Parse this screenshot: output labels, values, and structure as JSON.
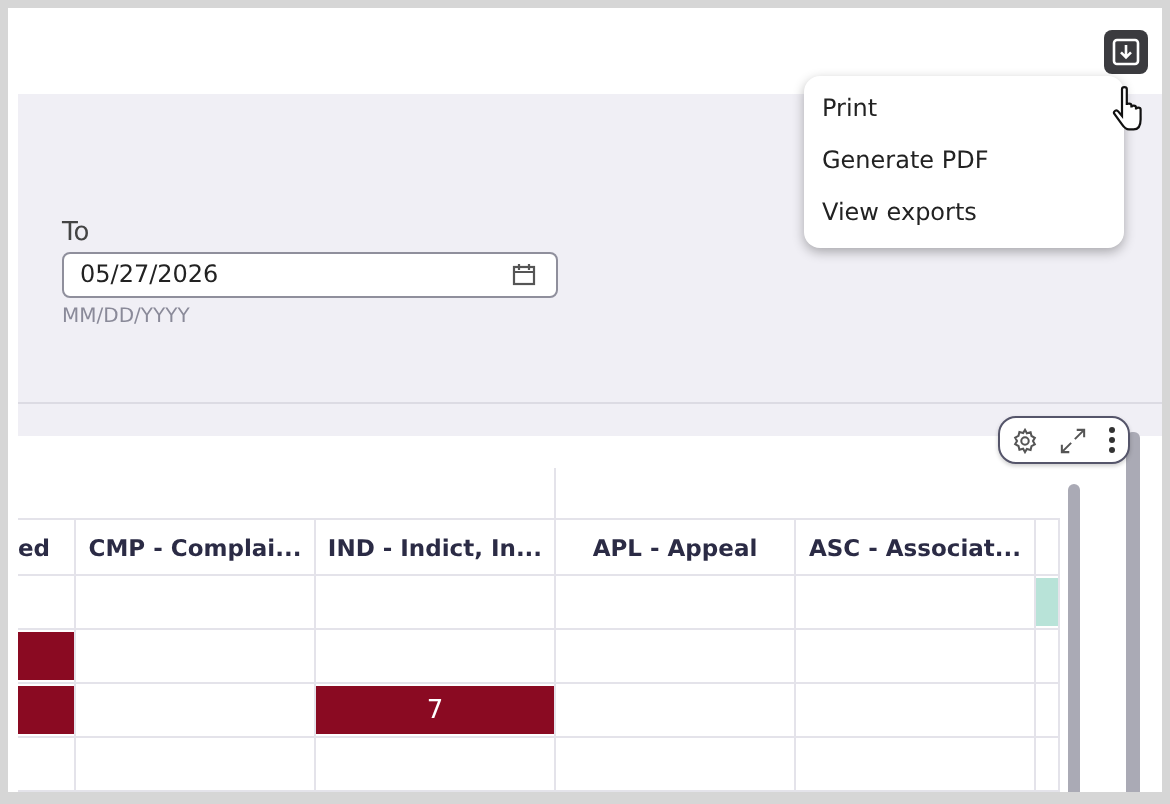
{
  "toolbar": {
    "download_button": {
      "kind": "download"
    }
  },
  "menu": {
    "items": [
      {
        "label": "Print"
      },
      {
        "label": "Generate PDF"
      },
      {
        "label": "View exports"
      }
    ]
  },
  "filters": {
    "date_to": {
      "label": "To",
      "value": "05/27/2026",
      "hint": "MM/DD/YYYY"
    }
  },
  "table": {
    "columns": [
      "ed",
      "CMP - Complai...",
      "IND - Indict, In...",
      "APL - Appeal",
      "ASC - Associat..."
    ],
    "rows": [
      [
        {},
        {},
        {},
        {},
        {},
        {
          "color": "#b8e3d8"
        }
      ],
      [
        {
          "color": "#8a0a22"
        },
        {},
        {},
        {},
        {},
        {}
      ],
      [
        {
          "color": "#8a0a22"
        },
        {},
        {
          "text": "7",
          "color": "#8a0a22"
        },
        {},
        {},
        {}
      ],
      [
        {},
        {},
        {},
        {},
        {},
        {}
      ]
    ]
  }
}
